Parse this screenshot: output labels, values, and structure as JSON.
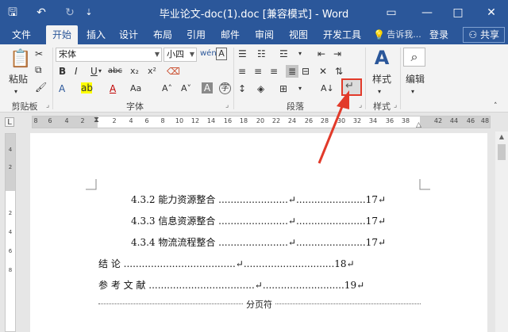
{
  "window": {
    "title": "毕业论文-doc(1).doc [兼容模式] - Word",
    "controls": {
      "ribbon_display": "▭",
      "minimize": "—",
      "maximize": "□",
      "close": "✕"
    }
  },
  "quick_access": {
    "save": "🖫",
    "undo": "↶",
    "redo": "↻",
    "customize": "⇣"
  },
  "tabs": [
    "文件",
    "开始",
    "插入",
    "设计",
    "布局",
    "引用",
    "邮件",
    "审阅",
    "视图",
    "开发工具"
  ],
  "tell_me": "告诉我...",
  "signin": "登录",
  "share": "共享",
  "ribbon": {
    "clipboard": {
      "label": "剪贴板",
      "paste": "粘贴"
    },
    "font": {
      "label": "字体",
      "font_name": "宋体",
      "font_size": "小四",
      "bold": "B",
      "italic": "I",
      "underline": "U",
      "strike": "abc",
      "subscript": "x₂",
      "superscript": "x²",
      "grow": "A˄",
      "shrink": "A˅",
      "change_case": "Aa"
    },
    "paragraph": {
      "label": "段落"
    },
    "styles": {
      "label": "样式",
      "button": "样式"
    },
    "editing": {
      "button": "编辑"
    }
  },
  "ruler": {
    "h_ticks": [
      "8",
      "6",
      "4",
      "2",
      "2",
      "4",
      "6",
      "8",
      "10",
      "12",
      "14",
      "16",
      "18",
      "20",
      "22",
      "24",
      "26",
      "28",
      "30",
      "32",
      "34",
      "36",
      "38",
      "42",
      "44",
      "46",
      "48"
    ],
    "v_ticks": [
      "4",
      "2",
      "2",
      "4",
      "6",
      "8"
    ],
    "corner": "L"
  },
  "document": {
    "toc": [
      {
        "text": "4.3.2 能力资源整合 .......................↵.......................17↵"
      },
      {
        "text": "4.3.3 信息资源整合 .......................↵.......................17↵"
      },
      {
        "text": "4.3.4 物流流程整合 .......................↵.......................17↵"
      },
      {
        "text": "结  论 .....................................↵..............................18↵"
      },
      {
        "text": "参 考 文 献 ...................................↵...........................19↵"
      }
    ],
    "page_break": "分页符"
  }
}
